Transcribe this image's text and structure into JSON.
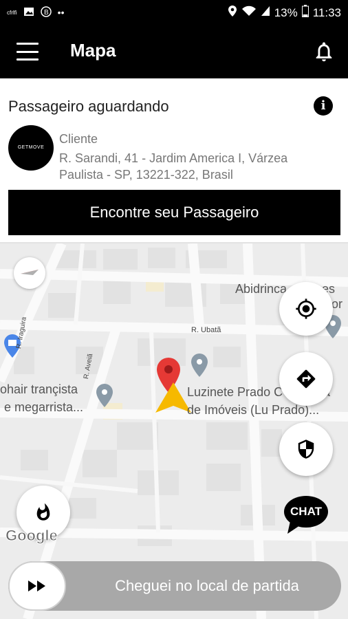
{
  "status_bar": {
    "left_icons": [
      "news-icon",
      "image-icon",
      "b-icon",
      "more-icon"
    ],
    "left_text": "cfrlfi",
    "battery": "13%",
    "time": "11:33"
  },
  "app_bar": {
    "title": "Mapa",
    "menu_icon": "hamburger-menu-icon",
    "notification_icon": "bell-icon"
  },
  "passenger_panel": {
    "title": "Passageiro aguardando",
    "avatar_text": "GETMOVE",
    "client_label": "Cliente",
    "address": "R. Sarandi, 41 - Jardim America I, Várzea Paulista - SP, 13221-322, Brasil",
    "find_button": "Encontre seu Passageiro"
  },
  "map": {
    "labels": {
      "place_top_right": "Abidrinca",
      "place_top_right_2": "es",
      "place_top_right_3": "or",
      "street_ubata": "R. Ubatã",
      "place_left_1": "ohair trançista",
      "place_left_2": "e megarrista...",
      "place_right_1": "Luzinete Prado C",
      "place_right_1b": "a",
      "place_right_2": "de Imóveis (Lu Prado)...",
      "street_vert_left": "R. Iraguira",
      "street_vert_mid": "R. Aveiã"
    },
    "google": "Google",
    "chat": "CHAT"
  },
  "slider": {
    "label": "Cheguei no local de partida",
    "thumb_icon": "fast-forward-icon"
  },
  "colors": {
    "bar": "#000000",
    "pin_red": "#e53935",
    "nav_arrow": "#f6b900",
    "slider_bg": "#a8a8a8"
  }
}
